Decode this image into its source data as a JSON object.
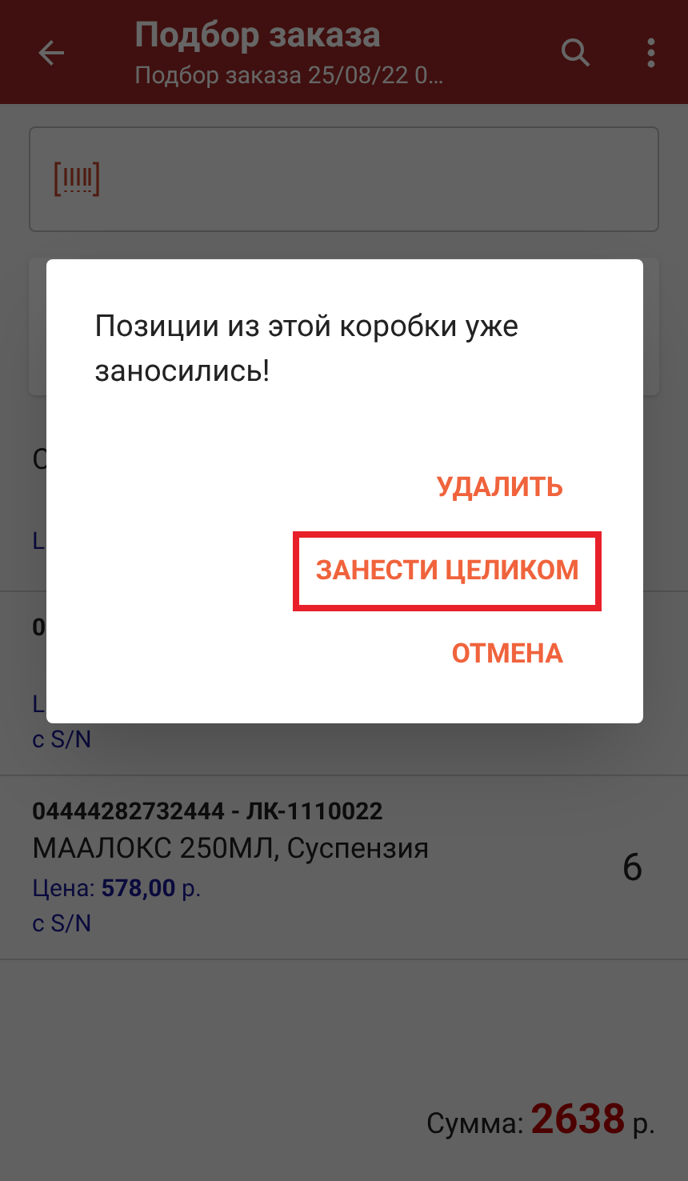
{
  "app_bar": {
    "title": "Подбор заказа",
    "subtitle": "Подбор заказа 25/08/22 0…"
  },
  "rows": [
    {
      "lines": [
        {
          "kind": "name",
          "text": "С"
        },
        {
          "kind": "blank"
        },
        {
          "kind": "price",
          "text": "L"
        }
      ]
    },
    {
      "lines": [
        {
          "kind": "code",
          "text": "0"
        },
        {
          "kind": "blank"
        },
        {
          "kind": "price",
          "text": "L"
        },
        {
          "kind": "serial",
          "text": "с S/N"
        }
      ]
    },
    {
      "lines": [
        {
          "kind": "code",
          "text": "04444282732444 - ЛК-1110022"
        },
        {
          "kind": "name",
          "text": "МААЛОКС 250МЛ, Суспензия"
        },
        {
          "kind": "price",
          "text": "Цена: **578,00** р."
        },
        {
          "kind": "serial",
          "text": "с S/N"
        }
      ],
      "quantity": "6"
    }
  ],
  "total": {
    "label": "Сумма:",
    "value": "2638",
    "currency": "р."
  },
  "dialog": {
    "message": "Позиции из этой коробки уже заносились!",
    "actions": [
      {
        "label": "УДАЛИТЬ",
        "highlighted": false
      },
      {
        "label": "ЗАНЕСТИ ЦЕЛИКОМ",
        "highlighted": true
      },
      {
        "label": "ОТМЕНА",
        "highlighted": false
      }
    ]
  }
}
